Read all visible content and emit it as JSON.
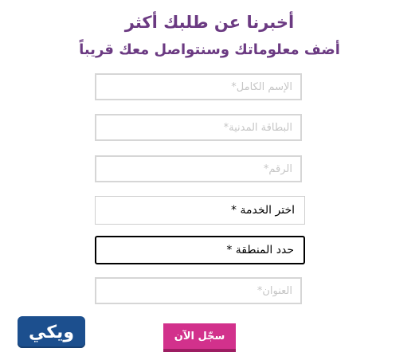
{
  "header": {
    "title": "أخبرنا عن طلبك أكثر",
    "subtitle": "أضف معلوماتك وسنتواصل معك قريباً"
  },
  "form": {
    "fullname_placeholder": "الإسم الكامل*",
    "civil_id_placeholder": "البطاقة المدنية*",
    "number_placeholder": "الرقم*",
    "service_select_label": "اختر الخدمة *",
    "region_select_label": "حدد المنطقة *",
    "address_placeholder": "العنوان*",
    "submit_label": "سجّل الآن"
  },
  "branding": {
    "logo_text": "ويكي",
    "logo_color": "#1c4f8e",
    "accent_color": "#d2318c",
    "title_color": "#6b3a82"
  }
}
